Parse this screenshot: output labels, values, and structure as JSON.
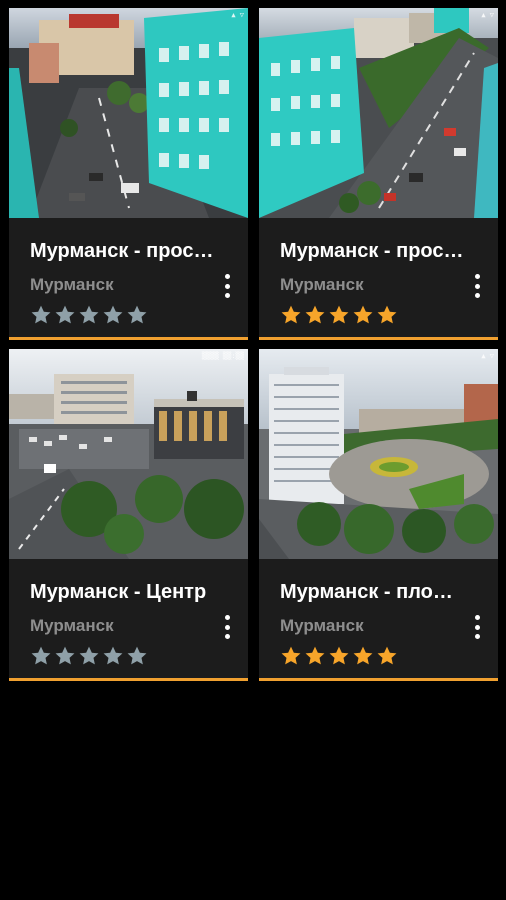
{
  "colors": {
    "background": "#000000",
    "card_background": "#1c1c1c",
    "accent_underline": "#f0a030",
    "star_filled": "#f7a52a",
    "star_empty": "#8fa0a8",
    "title_text": "#ffffff",
    "city_text": "#8e8e8e"
  },
  "cards": [
    {
      "title": "Мурманск - прос…",
      "city": "Мурманск",
      "rating": 0,
      "max_rating": 5,
      "thumbnail": "fisheye-street-turquoise-building",
      "menu_icon": "more-vert-icon"
    },
    {
      "title": "Мурманск - прос…",
      "city": "Мурманск",
      "rating": 5,
      "max_rating": 5,
      "thumbnail": "fisheye-avenue-turquoise-building",
      "menu_icon": "more-vert-icon"
    },
    {
      "title": "Мурманск - Центр",
      "city": "Мурманск",
      "rating": 0,
      "max_rating": 5,
      "thumbnail": "city-center-hotel-trees",
      "menu_icon": "more-vert-icon"
    },
    {
      "title": "Мурманск - пло…",
      "city": "Мурманск",
      "rating": 5,
      "max_rating": 5,
      "thumbnail": "square-with-flowerbed-tall-hotel",
      "menu_icon": "more-vert-icon"
    }
  ]
}
